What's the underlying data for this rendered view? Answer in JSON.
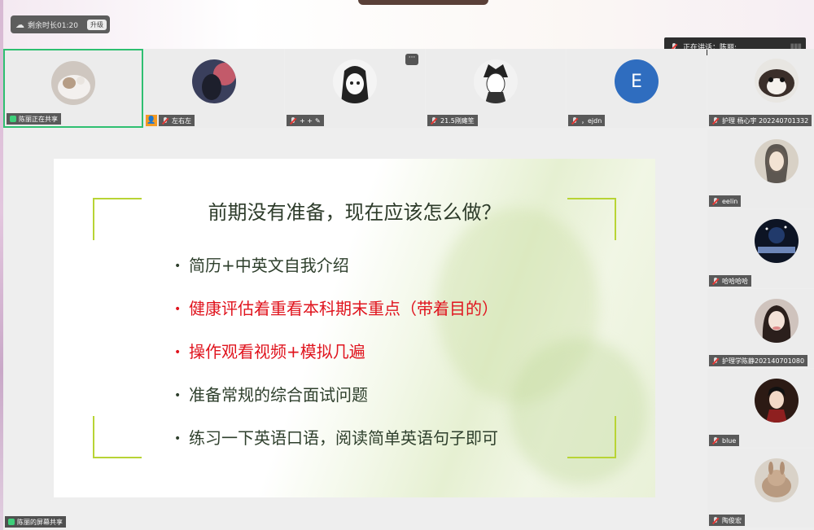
{
  "header": {
    "remaining": "剩余时长01:20",
    "upgrade": "升级",
    "speaking": "正在讲话：陈丽;"
  },
  "participants_top": [
    {
      "label": "陈丽正在共享"
    },
    {
      "label": "左右左"
    },
    {
      "label": "+ +"
    },
    {
      "label": "21.5刚瘫笙"
    },
    {
      "label": "，ejdn",
      "initial": "E"
    },
    {
      "label": "护理 杨心宇 202240701332"
    }
  ],
  "participants_right": [
    {
      "label": "eelin"
    },
    {
      "label": "哈哈哈哈"
    },
    {
      "label": "护理学陈静202140701080"
    },
    {
      "label": "blue"
    },
    {
      "label": "陶俊宏"
    }
  ],
  "share": {
    "label": "陈丽的屏幕共享",
    "slide": {
      "title": "前期没有准备，现在应该怎么做？",
      "bullets": [
        {
          "text": "简历+中英文自我介绍",
          "highlight": false
        },
        {
          "text": "健康评估着重看本科期末重点（带着目的）",
          "highlight": true
        },
        {
          "text": "操作观看视频+模拟几遍",
          "highlight": true
        },
        {
          "text": "准备常规的综合面试问题",
          "highlight": false
        },
        {
          "text": "练习一下英语口语，阅读简单英语句子即可",
          "highlight": false
        }
      ]
    }
  },
  "colors": {
    "active_border": "#2fbf71",
    "bracket": "#b8d435",
    "highlight_red": "#e0141e"
  }
}
